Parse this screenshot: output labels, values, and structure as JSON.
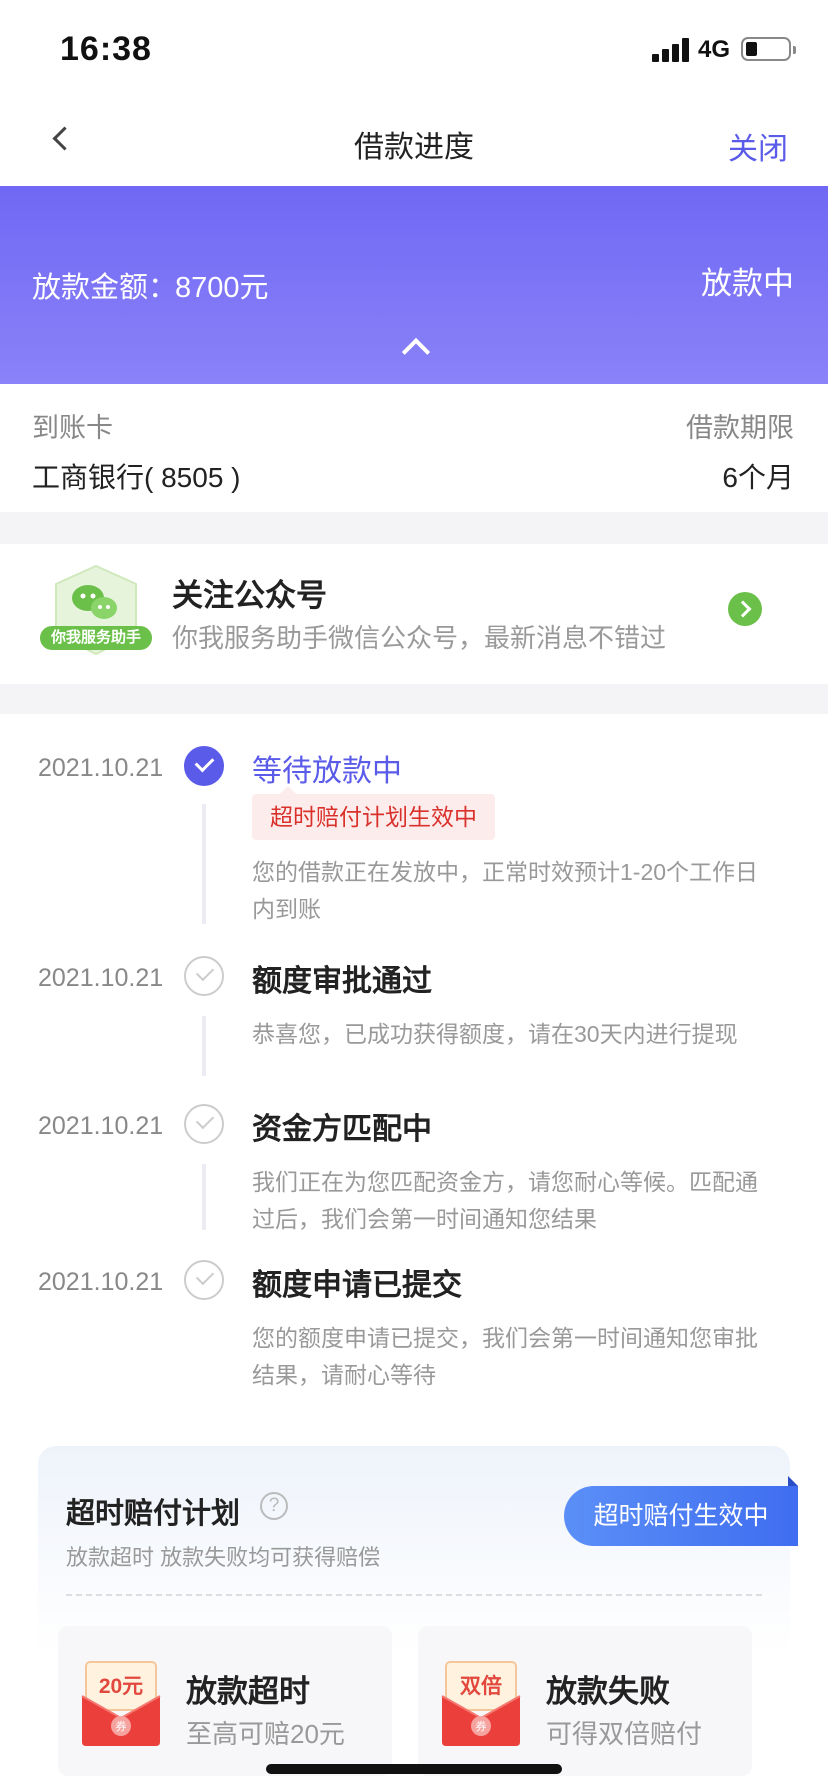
{
  "status_bar": {
    "time": "16:38",
    "network": "4G",
    "battery_level": 0.25
  },
  "nav": {
    "title": "借款进度",
    "close_label": "关闭"
  },
  "hero": {
    "amount_label": "放款金额：",
    "amount": "8700元",
    "status": "放款中"
  },
  "card_info": {
    "card_label": "到账卡",
    "card_value": "工商银行( 8505 )",
    "term_label": "借款期限",
    "term_value": "6个月"
  },
  "follow": {
    "badge": "你我服务助手",
    "title": "关注公众号",
    "subtitle": "你我服务助手微信公众号，最新消息不错过"
  },
  "timeline": [
    {
      "date": "2021.10.21",
      "title": "等待放款中",
      "tag": "超时赔付计划生效中",
      "desc1": "您的借款正在发放中，正常时效预计1-20个工作日",
      "desc2": "内到账"
    },
    {
      "date": "2021.10.21",
      "title": "额度审批通过",
      "desc1": "恭喜您，已成功获得额度，请在30天内进行提现"
    },
    {
      "date": "2021.10.21",
      "title": "资金方匹配中",
      "desc1": "我们正在为您匹配资金方，请您耐心等候。匹配通",
      "desc2": "过后，我们会第一时间通知您结果"
    },
    {
      "date": "2021.10.21",
      "title": "额度申请已提交",
      "desc1": "您的额度申请已提交，我们会第一时间通知您审批",
      "desc2": "结果，请耐心等待"
    }
  ],
  "compensation": {
    "title": "超时赔付计划",
    "help": "?",
    "subtitle": "放款超时 放款失败均可获得赔偿",
    "badge": "超时赔付生效中",
    "cards": [
      {
        "env_label": "20元",
        "coupon": "券",
        "title": "放款超时",
        "sub": "至高可赔20元"
      },
      {
        "env_label": "双倍",
        "coupon": "券",
        "title": "放款失败",
        "sub": "可得双倍赔付"
      }
    ]
  },
  "colors": {
    "accent": "#5b5bea",
    "hero_start": "#7068f4",
    "tag_red": "#d9312b",
    "wechat_green": "#6bc04a"
  }
}
